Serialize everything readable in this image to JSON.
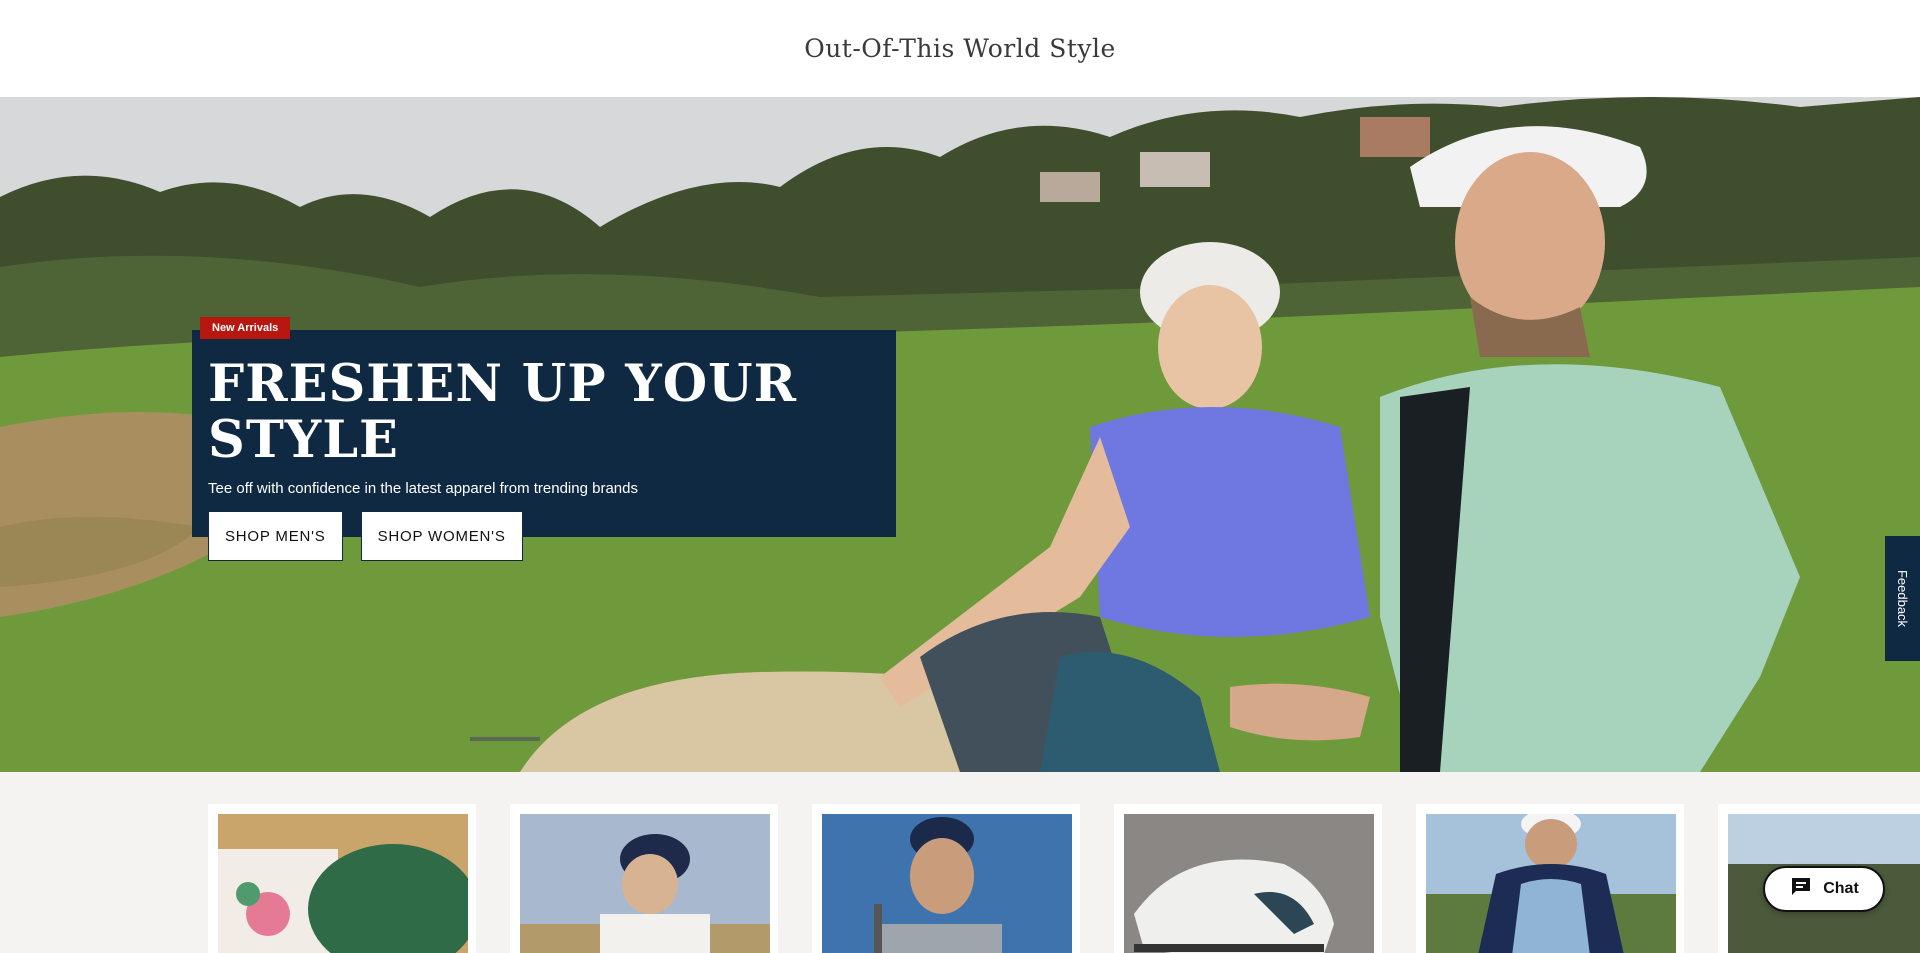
{
  "top_banner": {
    "text": "Out-Of-This World Style"
  },
  "hero": {
    "badge": "New Arrivals",
    "title": "FRESHEN UP YOUR STYLE",
    "subtitle": "Tee off with confidence in the latest apparel from trending brands",
    "buttons": [
      {
        "label": "SHOP MEN'S"
      },
      {
        "label": "SHOP WOMEN'S"
      }
    ]
  },
  "feedback": {
    "label": "Feedback"
  },
  "products": [
    {
      "name": "product-tile-1"
    },
    {
      "name": "product-tile-2"
    },
    {
      "name": "product-tile-3"
    },
    {
      "name": "product-tile-4"
    },
    {
      "name": "product-tile-5"
    },
    {
      "name": "product-tile-6"
    }
  ],
  "chat": {
    "label": "Chat",
    "icon": "chat-bubble-icon"
  },
  "colors": {
    "navy": "#0f2942",
    "badge_red": "#b7170f",
    "section_bg": "#f4f3f1"
  }
}
